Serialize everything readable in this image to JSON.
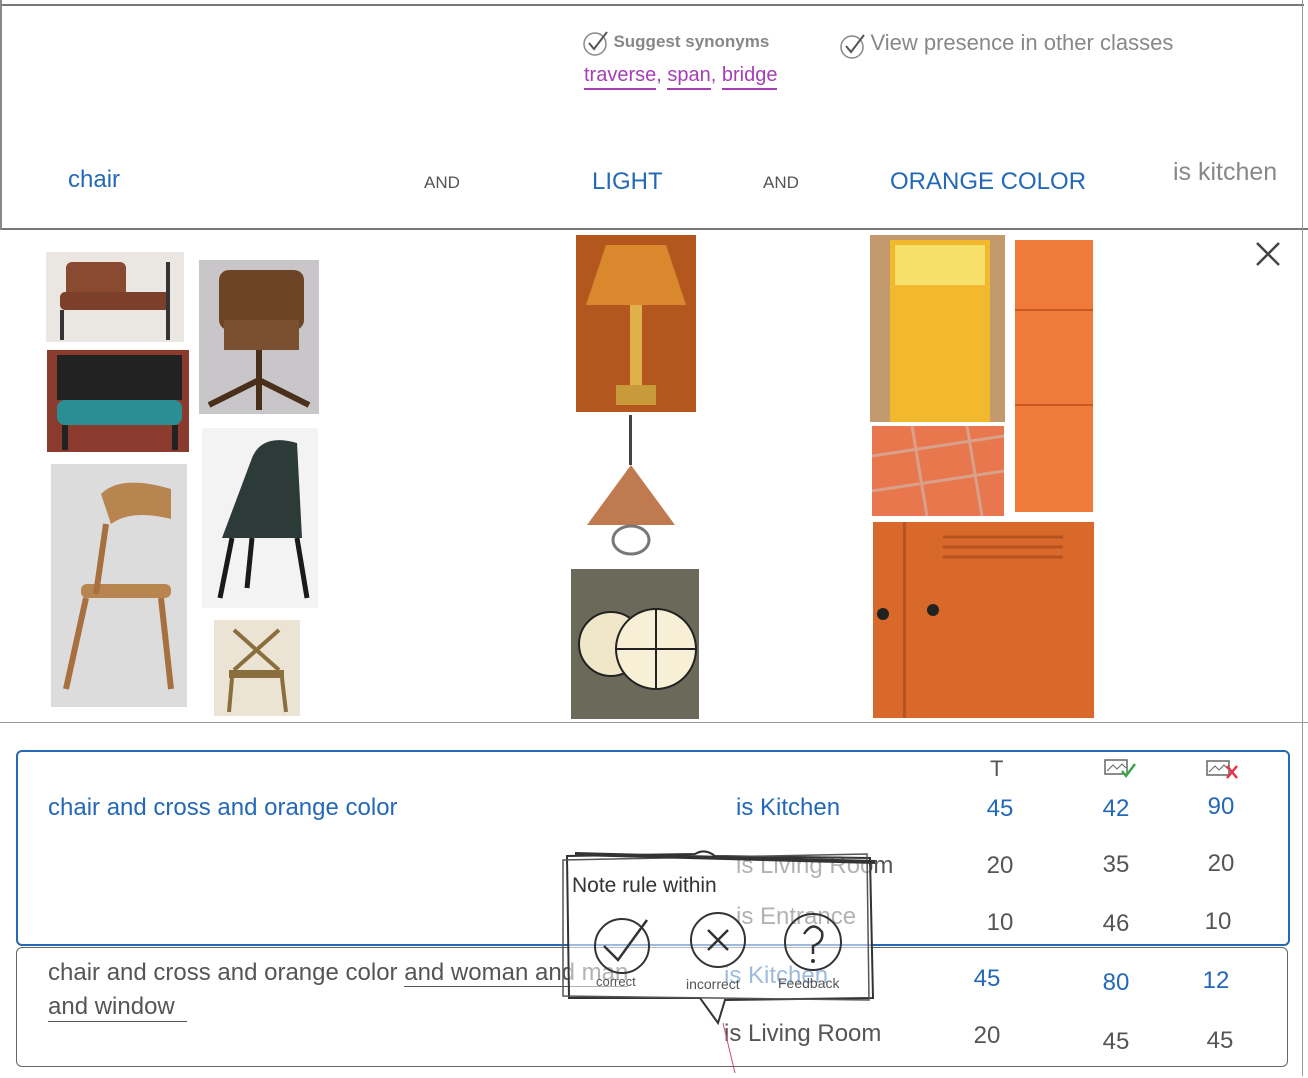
{
  "options": {
    "suggest_synonyms": "Suggest synonyms",
    "view_presence": "View presence in other classes",
    "synonyms": [
      "traverse",
      "span",
      "bridge"
    ]
  },
  "rule_builder": {
    "terms": [
      "chair",
      "LIGHT",
      "ORANGE COLOR"
    ],
    "connector": "AND",
    "result": "is kitchen"
  },
  "images": {
    "chair": [
      "leather armchair",
      "wooden swivel chair",
      "teal cushion chair",
      "bentwood chair",
      "dark upholstered chair",
      "cross-back chair"
    ],
    "light": [
      "table lamp",
      "copper pendant",
      "globe pendants"
    ],
    "orange": [
      "orange juice",
      "terracotta tiles",
      "orange locker",
      "orange cabinet"
    ]
  },
  "table": {
    "headers": [
      "T",
      "image-check-icon",
      "image-cross-icon"
    ],
    "rules": [
      {
        "condition": "chair and cross and orange color",
        "rows": [
          {
            "class": "is Kitchen",
            "t": "45",
            "correct": "42",
            "incorrect": "90"
          },
          {
            "class": "is Living Room",
            "t": "20",
            "correct": "35",
            "incorrect": "20"
          },
          {
            "class": "is Entrance",
            "t": "10",
            "correct": "46",
            "incorrect": "10"
          }
        ]
      },
      {
        "condition_part1": "chair and cross and orange color",
        "condition_part2": "and woman and man",
        "condition_part3": "and window",
        "rows": [
          {
            "class": "is Kitchen",
            "t": "45",
            "correct": "80",
            "incorrect": "12"
          },
          {
            "class": "is Living Room",
            "t": "20",
            "correct": "45",
            "incorrect": "45"
          }
        ]
      }
    ]
  },
  "popup": {
    "title": "Note rule within",
    "correct": "correct",
    "incorrect": "incorrect",
    "feedback": "Feedback"
  },
  "colors": {
    "accent_blue": "#2468b8",
    "synonym_purple": "#a43fb5"
  }
}
